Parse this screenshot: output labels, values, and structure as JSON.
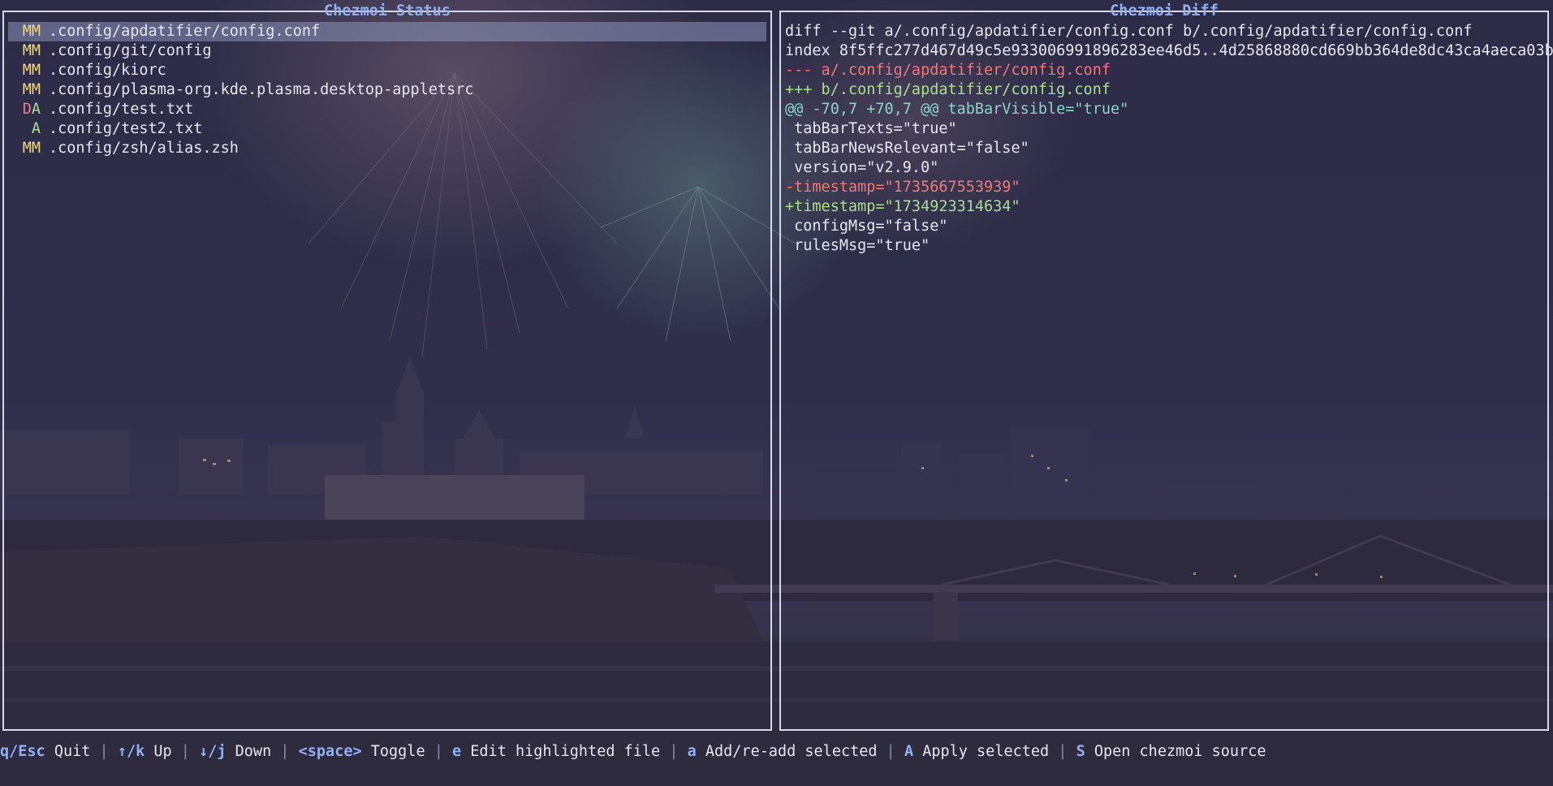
{
  "status_pane": {
    "title": "Chezmoi Status",
    "items": [
      {
        "c1": "M",
        "c2": "M",
        "c1_color": "yellow",
        "c2_color": "yellow",
        "path": ".config/apdatifier/config.conf",
        "highlighted": true
      },
      {
        "c1": "M",
        "c2": "M",
        "c1_color": "yellow",
        "c2_color": "yellow",
        "path": ".config/git/config",
        "highlighted": false
      },
      {
        "c1": "M",
        "c2": "M",
        "c1_color": "yellow",
        "c2_color": "yellow",
        "path": ".config/kiorc",
        "highlighted": false
      },
      {
        "c1": "M",
        "c2": "M",
        "c1_color": "yellow",
        "c2_color": "yellow",
        "path": ".config/plasma-org.kde.plasma.desktop-appletsrc",
        "highlighted": false
      },
      {
        "c1": "D",
        "c2": "A",
        "c1_color": "red",
        "c2_color": "green",
        "path": ".config/test.txt",
        "highlighted": false
      },
      {
        "c1": " ",
        "c2": "A",
        "c1_color": "yellow",
        "c2_color": "green",
        "path": ".config/test2.txt",
        "highlighted": false
      },
      {
        "c1": "M",
        "c2": "M",
        "c1_color": "yellow",
        "c2_color": "yellow",
        "path": ".config/zsh/alias.zsh",
        "highlighted": false
      }
    ]
  },
  "diff_pane": {
    "title": "Chezmoi Diff",
    "lines": [
      {
        "kind": "header",
        "text": "diff --git a/.config/apdatifier/config.conf b/.config/apdatifier/config.conf"
      },
      {
        "kind": "header",
        "text": "index 8f5ffc277d467d49c5e933006991896283ee46d5..4d25868880cd669bb364de8dc43ca4aeca03b"
      },
      {
        "kind": "minus",
        "text": "--- a/.config/apdatifier/config.conf"
      },
      {
        "kind": "plus",
        "text": "+++ b/.config/apdatifier/config.conf"
      },
      {
        "kind": "hunk",
        "text": "@@ -70,7 +70,7 @@ tabBarVisible=\"true\""
      },
      {
        "kind": "ctx",
        "text": " tabBarTexts=\"true\""
      },
      {
        "kind": "ctx",
        "text": " tabBarNewsRelevant=\"false\""
      },
      {
        "kind": "ctx",
        "text": " version=\"v2.9.0\""
      },
      {
        "kind": "minus",
        "text": "-timestamp=\"1735667553939\""
      },
      {
        "kind": "plus",
        "text": "+timestamp=\"1734923314634\""
      },
      {
        "kind": "ctx",
        "text": " configMsg=\"false\""
      },
      {
        "kind": "ctx",
        "text": " rulesMsg=\"true\""
      }
    ]
  },
  "footer": {
    "bindings": [
      {
        "key": "q/Esc",
        "desc": "Quit"
      },
      {
        "key": "↑/k",
        "desc": "Up"
      },
      {
        "key": "↓/j",
        "desc": "Down"
      },
      {
        "key": "<space>",
        "desc": "Toggle"
      },
      {
        "key": "e",
        "desc": "Edit highlighted file"
      },
      {
        "key": "a",
        "desc": "Add/re-add selected"
      },
      {
        "key": "A",
        "desc": "Apply selected"
      },
      {
        "key": "S",
        "desc": "Open chezmoi source"
      }
    ],
    "separator": "|"
  },
  "colors": {
    "key_accent": "#8fb0f7",
    "title_accent": "#8fb0f7",
    "status_yellow": "#f0d77a",
    "status_red": "#f07890",
    "status_green": "#a6e08e",
    "diff_minus": "#f07878",
    "diff_plus": "#a6e08e",
    "diff_hunk": "#8bd5c8",
    "highlight_row": "#8c94ba"
  }
}
